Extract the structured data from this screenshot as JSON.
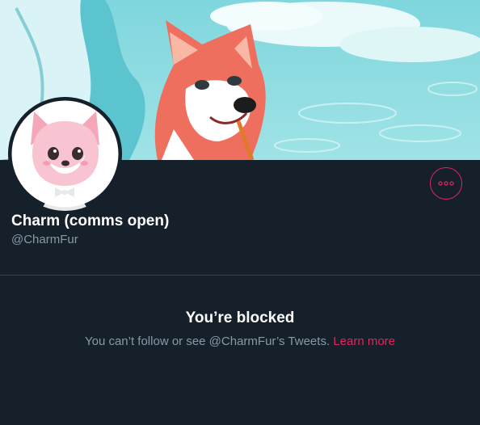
{
  "profile": {
    "name": "Charm (comms open)",
    "handle": "@CharmFur",
    "accent_color": "#e0245e",
    "more_icon": "more-horizontal-icon"
  },
  "blocked": {
    "title": "You’re blocked",
    "message": "You can’t follow or see @CharmFur’s Tweets.",
    "learn_more": "Learn more"
  },
  "colors": {
    "background": "#15202b",
    "divider": "#38444d",
    "secondary_text": "#8899a6"
  }
}
